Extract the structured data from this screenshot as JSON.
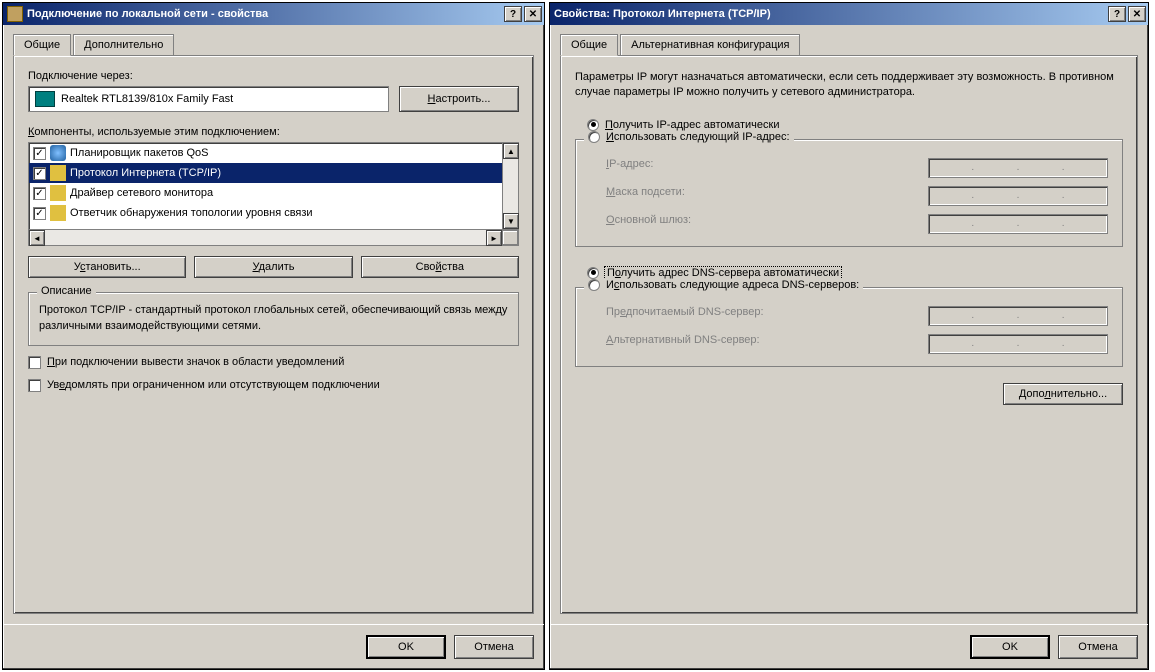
{
  "left": {
    "title": "Подключение по локальной сети - свойства",
    "tabs": {
      "general": "Общие",
      "advanced": "Дополнительно"
    },
    "connect_via_label": "Подключение через:",
    "adapter_name": "Realtek RTL8139/810x Family Fast",
    "configure_btn": "Настроить...",
    "components_label": "Компоненты, используемые этим подключением:",
    "items": {
      "qos": "Планировщик пакетов QoS",
      "tcpip": "Протокол Интернета (TCP/IP)",
      "netmon": "Драйвер сетевого монитора",
      "lldp": "Ответчик обнаружения топологии уровня связи"
    },
    "install_btn": "Установить...",
    "remove_btn": "Удалить",
    "props_btn": "Свойства",
    "desc_title": "Описание",
    "desc_text": "Протокол TCP/IP - стандартный протокол глобальных сетей, обеспечивающий связь между различными взаимодействующими сетями.",
    "chk_tray": "При подключении вывести значок в области уведомлений",
    "chk_limited": "Уведомлять при ограниченном или отсутствующем подключении",
    "ok": "OK",
    "cancel": "Отмена"
  },
  "right": {
    "title": "Свойства: Протокол Интернета (TCP/IP)",
    "tabs": {
      "general": "Общие",
      "alt": "Альтернативная конфигурация"
    },
    "info": "Параметры IP могут назначаться автоматически, если сеть поддерживает эту возможность. В противном случае параметры IP можно получить у сетевого администратора.",
    "radio_auto_ip": "Получить IP-адрес автоматически",
    "radio_manual_ip": "Использовать следующий IP-адрес:",
    "ip_label": "IP-адрес:",
    "mask_label": "Маска подсети:",
    "gw_label": "Основной шлюз:",
    "radio_auto_dns": "Получить адрес DNS-сервера автоматически",
    "radio_manual_dns": "Использовать следующие адреса DNS-серверов:",
    "dns_pref_label": "Предпочитаемый DNS-сервер:",
    "dns_alt_label": "Альтернативный DNS-сервер:",
    "advanced_btn": "Дополнительно...",
    "ok": "OK",
    "cancel": "Отмена"
  }
}
